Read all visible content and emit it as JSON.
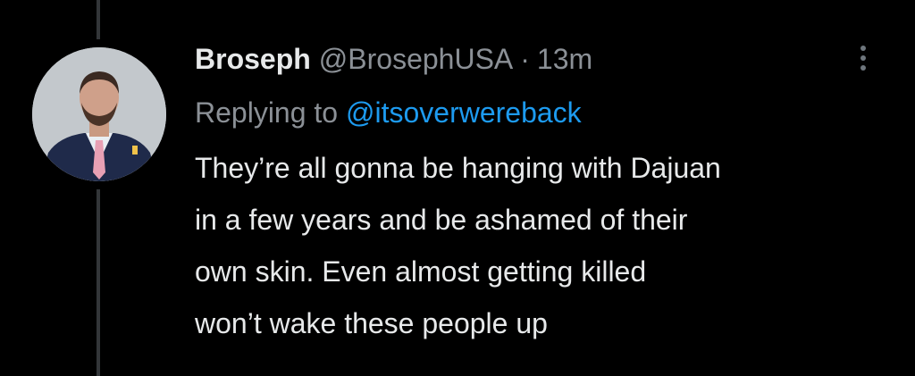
{
  "tweet": {
    "display_name": "Broseph",
    "handle": "@BrosephUSA",
    "separator": "·",
    "time": "13m",
    "replying_prefix": "Replying to",
    "replying_to": "@itsoverwereback",
    "body_lines": [
      "They’re all gonna be hanging with Dajuan",
      "in a few years and be ashamed of their",
      "own skin. Even almost getting killed",
      "won’t wake these people up"
    ]
  },
  "icons": {
    "more": "more-vertical-icon",
    "avatar": "profile-photo"
  },
  "colors": {
    "background": "#000000",
    "text_primary": "#e7e9ea",
    "text_secondary": "#8b9096",
    "link": "#1d9bf0",
    "thread_line": "#333639"
  }
}
